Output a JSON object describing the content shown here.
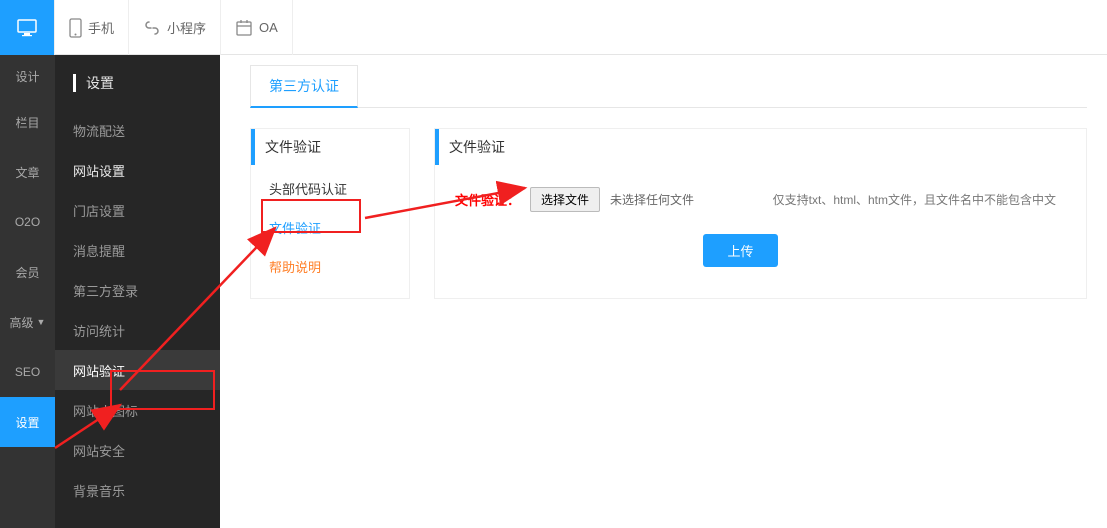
{
  "topbar": {
    "items": [
      {
        "name": "desktop-icon",
        "label": ""
      },
      {
        "name": "phone-icon",
        "label": "手机"
      },
      {
        "name": "miniprogram-icon",
        "label": "小程序"
      },
      {
        "name": "oa-icon",
        "label": "OA"
      }
    ]
  },
  "nav1": {
    "items": [
      {
        "label": "设计"
      },
      {
        "label": "栏目"
      },
      {
        "label": "文章"
      },
      {
        "label": "O2O"
      },
      {
        "label": "会员"
      },
      {
        "label": "高级",
        "caret": true
      },
      {
        "label": "SEO"
      },
      {
        "label": "设置",
        "active": true
      }
    ]
  },
  "nav2": {
    "title": "设置",
    "items": [
      {
        "label": "物流配送"
      },
      {
        "label": "网站设置",
        "section_head": true
      },
      {
        "label": "门店设置"
      },
      {
        "label": "消息提醒"
      },
      {
        "label": "第三方登录"
      },
      {
        "label": "访问统计"
      },
      {
        "label": "网站验证",
        "selected": true
      },
      {
        "label": "网站小图标"
      },
      {
        "label": "网站安全"
      },
      {
        "label": "背景音乐"
      }
    ]
  },
  "main": {
    "tab": "第三方认证",
    "side_panel": {
      "title": "文件验证",
      "items": [
        {
          "label": "头部代码认证"
        },
        {
          "label": "文件验证",
          "active": true
        }
      ],
      "help": "帮助说明"
    },
    "content_panel": {
      "title": "文件验证",
      "field_label": "文件验证：",
      "file_btn": "选择文件",
      "file_status": "未选择任何文件",
      "hint": "仅支持txt、html、htm文件，且文件名中不能包含中文",
      "upload": "上传"
    }
  }
}
